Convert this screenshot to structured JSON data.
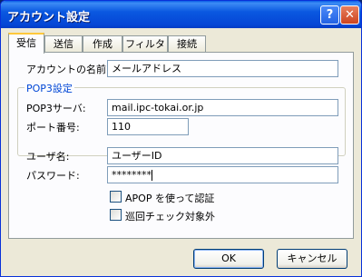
{
  "window": {
    "title": "アカウント設定"
  },
  "titlebar_buttons": {
    "help": "?",
    "close": "✕"
  },
  "tabs": [
    "受信",
    "送信",
    "作成",
    "フィルタ",
    "接続"
  ],
  "form": {
    "account_name_label": "アカウントの名前:",
    "account_name_value": "メールアドレス",
    "group_title": "POP3設定",
    "pop3_server_label": "POP3サーバ:",
    "pop3_server_value": "mail.ipc-tokai.or.jp",
    "port_label": "ポート番号:",
    "port_value": "110",
    "username_label": "ユーザ名:",
    "username_value": "ユーザーID",
    "password_label": "パスワード:",
    "password_value": "********",
    "apop_label": "APOP を使って認証",
    "patrol_label": "巡回チェック対象外"
  },
  "buttons": {
    "ok": "OK",
    "cancel": "キャンセル"
  }
}
